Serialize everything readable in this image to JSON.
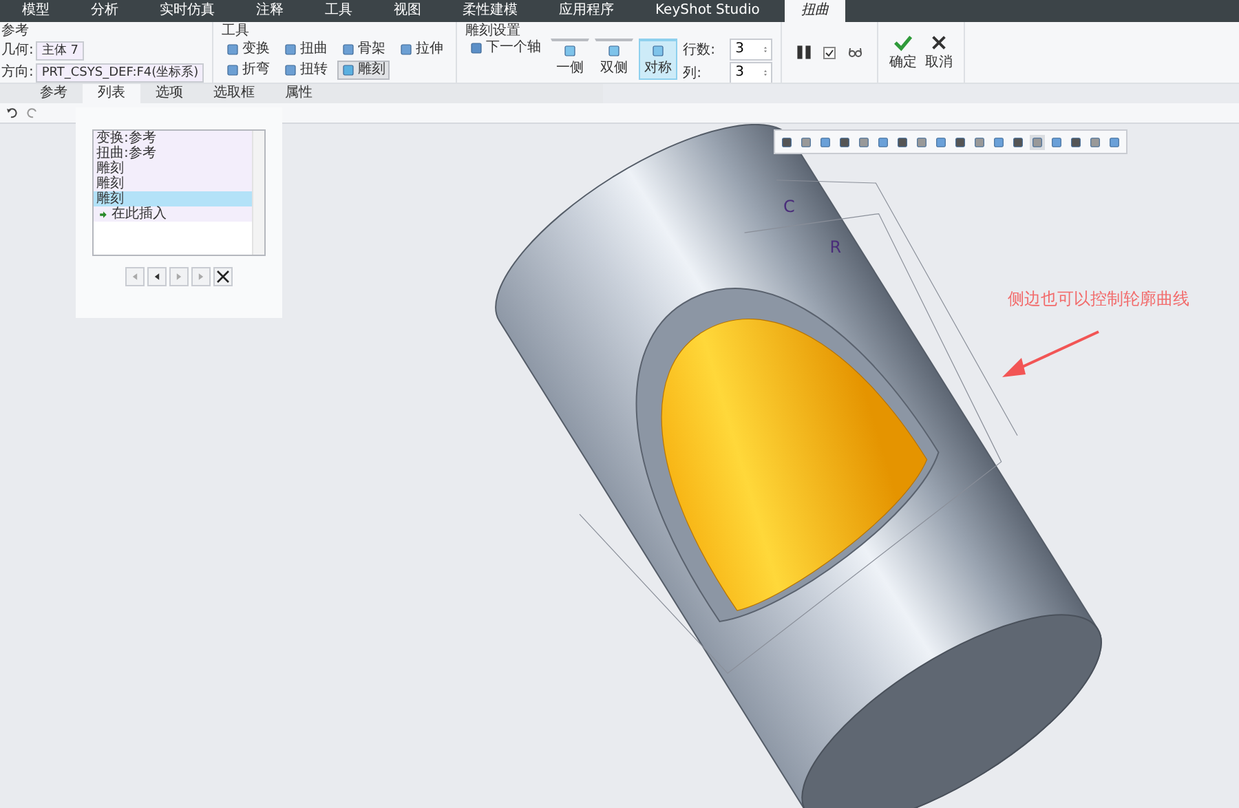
{
  "menu_tabs": [
    {
      "label": "模型",
      "selected": false
    },
    {
      "label": "分析",
      "selected": false
    },
    {
      "label": "实时仿真",
      "selected": false
    },
    {
      "label": "注释",
      "selected": false
    },
    {
      "label": "工具",
      "selected": false
    },
    {
      "label": "视图",
      "selected": false
    },
    {
      "label": "柔性建模",
      "selected": false
    },
    {
      "label": "应用程序",
      "selected": false
    },
    {
      "label": "KeyShot Studio",
      "selected": false
    },
    {
      "label": "扭曲",
      "selected": true
    }
  ],
  "reference": {
    "title": "参考",
    "fields": [
      {
        "label": "几何:",
        "value": "主体 7"
      },
      {
        "label": "方向:",
        "value": "PRT_CSYS_DEF:F4(坐标系)"
      }
    ]
  },
  "tools": {
    "title": "工具",
    "items": [
      {
        "label": "变换",
        "selected": false
      },
      {
        "label": "扭曲",
        "selected": false
      },
      {
        "label": "骨架",
        "selected": false
      },
      {
        "label": "拉伸",
        "selected": false
      },
      {
        "label": "折弯",
        "selected": false
      },
      {
        "label": "扭转",
        "selected": false
      },
      {
        "label": "雕刻",
        "selected": true
      }
    ]
  },
  "engrave": {
    "title": "雕刻设置",
    "next_axis": "下一个轴",
    "modes": [
      {
        "label": "一侧",
        "selected": false
      },
      {
        "label": "双侧",
        "selected": false
      },
      {
        "label": "对称",
        "selected": true
      }
    ],
    "spinners": [
      {
        "label": "行数:",
        "value": "3"
      },
      {
        "label": "列:",
        "value": "3"
      }
    ]
  },
  "preview": {
    "checked": true
  },
  "actions": [
    {
      "label": "确定",
      "kind": "ok"
    },
    {
      "label": "取消",
      "kind": "cancel"
    }
  ],
  "panel_tabs": [
    {
      "label": "参考",
      "selected": false
    },
    {
      "label": "列表",
      "selected": true
    },
    {
      "label": "选项",
      "selected": false
    },
    {
      "label": "选取框",
      "selected": false
    },
    {
      "label": "属性",
      "selected": false
    }
  ],
  "list_items": [
    {
      "label": "变换:参考",
      "kind": "item",
      "selected": false
    },
    {
      "label": "扭曲:参考",
      "kind": "item",
      "selected": false
    },
    {
      "label": "雕刻",
      "kind": "item",
      "selected": false
    },
    {
      "label": "雕刻",
      "kind": "item",
      "selected": false
    },
    {
      "label": "雕刻",
      "kind": "item",
      "selected": true
    },
    {
      "label": "在此插入",
      "kind": "insert",
      "selected": false
    }
  ],
  "model_labels": [
    "C",
    "R"
  ],
  "annotation": "侧边也可以控制轮廓曲线"
}
